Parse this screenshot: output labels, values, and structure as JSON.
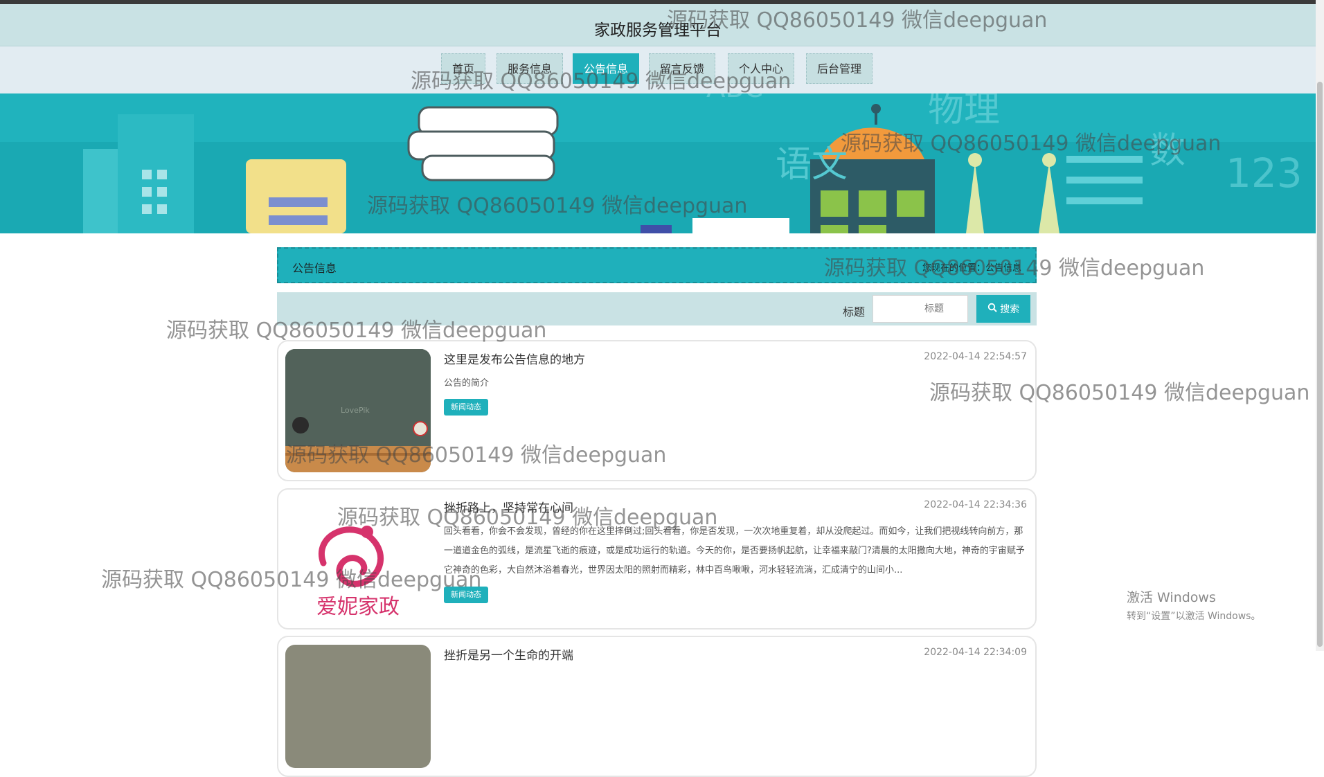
{
  "header": {
    "title": "家政服务管理平台"
  },
  "nav": {
    "items": [
      {
        "label": "首页"
      },
      {
        "label": "服务信息"
      },
      {
        "label": "公告信息"
      },
      {
        "label": "留言反馈"
      },
      {
        "label": "个人中心"
      },
      {
        "label": "后台管理"
      }
    ],
    "active_index": 2
  },
  "section": {
    "title": "公告信息",
    "breadcrumb": "您现在的位置：公告信息"
  },
  "search": {
    "label": "标题",
    "placeholder": "标题",
    "button_label": "搜索"
  },
  "announcements": [
    {
      "title": "这里是发布公告信息的地方",
      "time": "2022-04-14 22:54:57",
      "summary": "公告的简介",
      "tag": "新闻动态"
    },
    {
      "title": "挫折路上，坚持常在心间",
      "time": "2022-04-14 22:34:36",
      "summary": "回头看看，你会不会发现，曾经的你在这里摔倒过;回头看看，你是否发现，一次次地重复着，却从没爬起过。而如今，让我们把视线转向前方，那一道道金色的弧线，是流星飞逝的痕迹，或是成功运行的轨道。今天的你，是否要扬帆起航，让幸福来敲门?清晨的太阳撒向大地，神奇的宇宙赋予它神奇的色彩，大自然沐浴着春光，世界因太阳的照射而精彩，林中百鸟啾啾，河水轻轻流淌，汇成清宁的山间小...",
      "tag": "新闻动态",
      "thumb_text": "爱妮家政"
    },
    {
      "title": "挫折是另一个生命的开端",
      "time": "2022-04-14 22:34:09"
    }
  ],
  "banner": {
    "words": [
      "物理",
      "语文",
      "数",
      "123",
      "ABC"
    ]
  },
  "thumb1_text": "LovePik",
  "watermark_text": "源码获取 QQ86050149 微信deepguan",
  "system": {
    "activate_title": "激活 Windows",
    "activate_sub": "转到“设置”以激活 Windows。"
  },
  "colors": {
    "accent": "#1fb0bb",
    "header_bg": "#c9e2e4",
    "nav_bg": "#e2ecf2",
    "brand_pink": "#d6336c"
  }
}
